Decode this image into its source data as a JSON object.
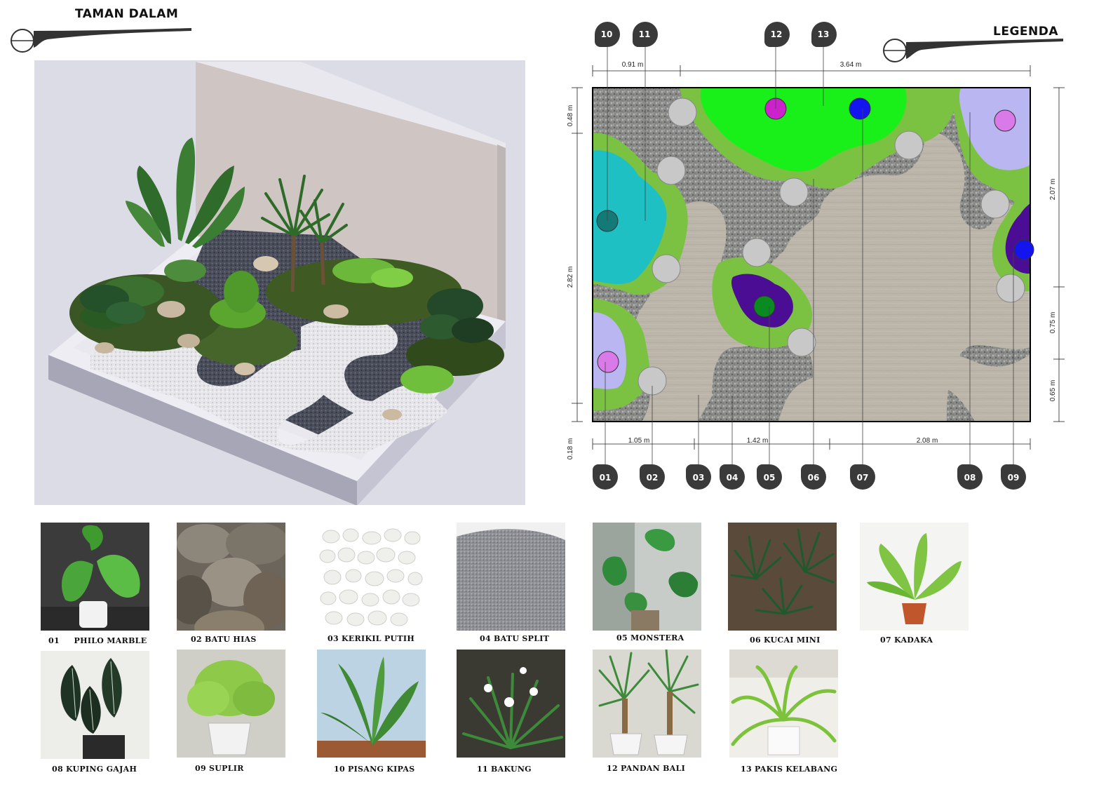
{
  "header_left": {
    "title": "TAMAN DALAM"
  },
  "header_right": {
    "title": "LEGENDA"
  },
  "plan": {
    "top_markers": [
      "10",
      "11",
      "12",
      "13"
    ],
    "bottom_markers": [
      "01",
      "02",
      "03",
      "04",
      "05",
      "06",
      "07",
      "08",
      "09"
    ],
    "dims_top": [
      "0.91 m",
      "3.64 m"
    ],
    "dims_bottom": [
      "1.05 m",
      "1.42 m",
      "2.08 m"
    ],
    "dims_left": [
      "0.48 m",
      "2.82 m",
      "0.18 m"
    ],
    "dims_right": [
      "2.07 m",
      "0.75 m",
      "0.65 m"
    ],
    "colors": {
      "gravel_dark": "#8a8a88",
      "paving": "#bcb5aa",
      "grass": "#7cc242",
      "lawn_bright": "#19f019",
      "cyan_bed": "#1ec0c4",
      "lavender_bed": "#b9b6f2",
      "purple_bed": "#4b0d93",
      "stone": "#c8c8c8",
      "magenta": "#cc22cc",
      "blue": "#1414ee"
    }
  },
  "legend": [
    {
      "code": "01",
      "caption": "01     PHILO MARBLE",
      "icon": "philodendron-icon"
    },
    {
      "code": "02",
      "caption": "02 BATU HIAS",
      "icon": "boulder-icon"
    },
    {
      "code": "03",
      "caption": "03 KERIKIL PUTIH",
      "icon": "white-pebble-icon"
    },
    {
      "code": "04",
      "caption": "04 BATU SPLIT",
      "icon": "gravel-icon"
    },
    {
      "code": "05",
      "caption": "05 MONSTERA",
      "icon": "monstera-icon"
    },
    {
      "code": "06",
      "caption": "06 KUCAI MINI",
      "icon": "mondo-grass-icon"
    },
    {
      "code": "07",
      "caption": "07 KADAKA",
      "icon": "birds-nest-fern-icon"
    },
    {
      "code": "08",
      "caption": "08 KUPING GAJAH",
      "icon": "anthurium-icon"
    },
    {
      "code": "09",
      "caption": "09 SUPLIR",
      "icon": "maidenhair-fern-icon"
    },
    {
      "code": "10",
      "caption": "10 PISANG KIPAS",
      "icon": "travellers-palm-icon"
    },
    {
      "code": "11",
      "caption": "11 BAKUNG",
      "icon": "spider-lily-icon"
    },
    {
      "code": "12",
      "caption": "12 PANDAN BALI",
      "icon": "pandan-bali-icon"
    },
    {
      "code": "13",
      "caption": "13 PAKIS KELABANG",
      "icon": "boston-fern-icon"
    }
  ]
}
